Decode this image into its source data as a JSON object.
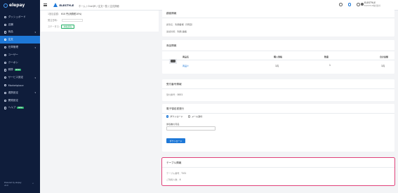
{
  "sidebar": {
    "logo": "elepay",
    "items": [
      {
        "label": "ダッシュボード",
        "active": false,
        "chevron": false
      },
      {
        "label": "店舗",
        "active": false,
        "chevron": false
      },
      {
        "label": "商品",
        "active": false,
        "chevron": true
      },
      {
        "label": "注文",
        "active": true,
        "chevron": false
      },
      {
        "label": "在庫管理",
        "active": false,
        "chevron": true
      },
      {
        "label": "ユーザー",
        "active": false,
        "chevron": false
      },
      {
        "label": "クーポン",
        "active": false,
        "chevron": false
      },
      {
        "label": "精算",
        "active": false,
        "chevron": false,
        "badge": "NEW"
      },
      {
        "label": "サービス設定",
        "active": false,
        "chevron": true
      },
      {
        "label": "Marketplace",
        "active": false,
        "chevron": false
      },
      {
        "label": "連携設定",
        "active": false,
        "chevron": true
      },
      {
        "label": "開発設定",
        "active": false,
        "chevron": false
      },
      {
        "label": "ヘルプ",
        "active": false,
        "chevron": false,
        "badge": "NEW"
      }
    ],
    "footer": [
      "Powered by elepay",
      "v2.0"
    ],
    "collapse_icon": "«"
  },
  "header": {
    "brand": "ELESTYLE",
    "breadcrumb": "ホーム / OneQR / 注文一覧 / 注文詳細",
    "user_name": "ELESTYLE",
    "user_sub": "ELESTYLE株式会社"
  },
  "left_panel": {
    "amount_label": "1回目金額：",
    "amount_value": "¥10 円(消費税10%)",
    "note_label": "受注日時：",
    "status_label": "ステータス：",
    "status_value": "支払済み"
  },
  "customer": {
    "title": "顧客情報",
    "rows": [
      {
        "label": "顧客名：",
        "value": "利用者様（2周目）"
      },
      {
        "label": "連絡情報：",
        "value": "利用 連絡"
      }
    ]
  },
  "products": {
    "title": "商品情報",
    "columns": [
      "商品名",
      "購入価格",
      "数量",
      "合計金額"
    ],
    "rows": [
      {
        "name": "商品①",
        "price": "1円",
        "qty": "1",
        "total": "1円"
      }
    ]
  },
  "receipt_number": {
    "title": "受付番号情報",
    "label": "受付番号：",
    "value": "0001"
  },
  "e_receipt": {
    "title": "電子領収書発行",
    "options": [
      "ダウンロード",
      "メール送付"
    ],
    "selected": 0,
    "field_label": "領収書の宛名",
    "field_placeholder": "",
    "button_label": "ダウンロード"
  },
  "table_info": {
    "title": "テーブル情報",
    "rows": [
      {
        "label": "テーブル番号：",
        "value": "T-01"
      },
      {
        "label": "ご利用人数：",
        "value": "4"
      }
    ]
  },
  "colors": {
    "sidebar_bg": "#0f1d3b",
    "accent": "#1e78d7",
    "highlight": "#e0417a",
    "status_green": "#29b36b"
  }
}
